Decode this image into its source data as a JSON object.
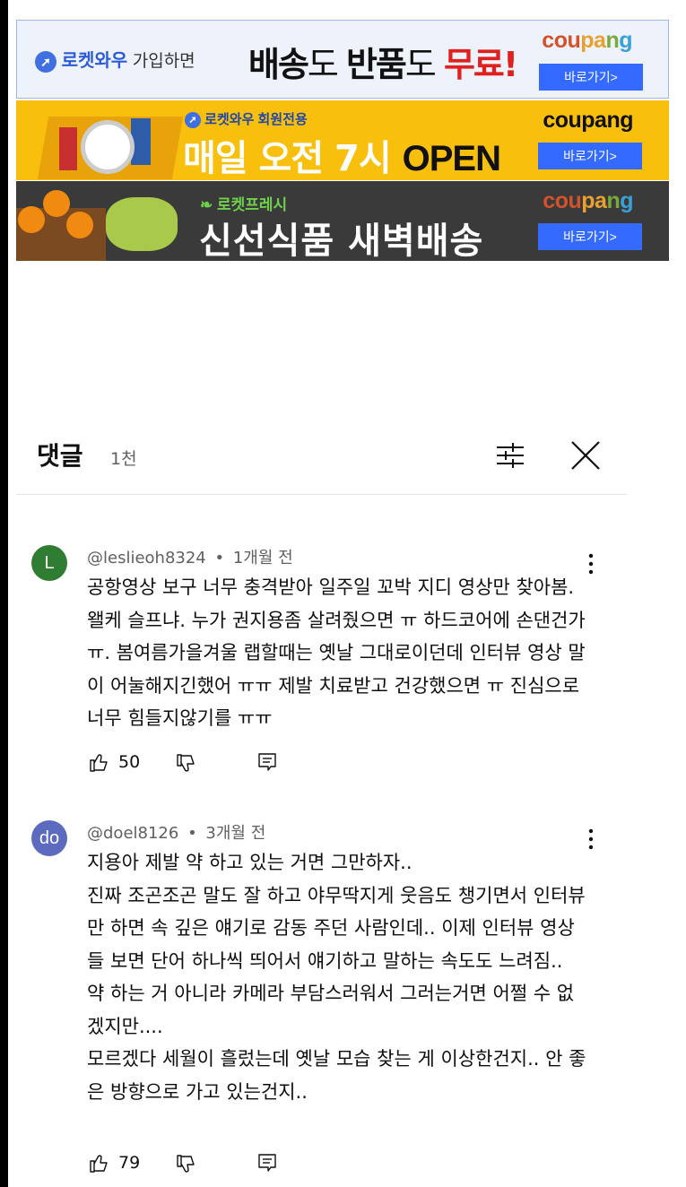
{
  "ads": {
    "banner1": {
      "brand": "로켓와우",
      "line": "가입하면",
      "big_a": "배송",
      "big_b": "도 ",
      "big_c": "반품",
      "big_d": "도 ",
      "big_e": "무료!",
      "button": "바로가기>"
    },
    "banner2": {
      "sub": "로켓와우 회원전용",
      "main_a": "매일 오전 7시 ",
      "main_b": "OPEN",
      "logo": "coupang",
      "button": "바로가기>"
    },
    "banner3": {
      "sub": "로켓프레시",
      "main": "신선식품 새벽배송",
      "button": "바로가기>"
    },
    "logo_parts": [
      "cou",
      "pa",
      "n",
      "g"
    ]
  },
  "comments_header": {
    "title": "댓글",
    "count": "1천"
  },
  "comments": [
    {
      "avatar_letter": "L",
      "avatar_color": "#2e7d32",
      "author": "@leslieoh8324",
      "dot": "•",
      "time": "1개월 전",
      "text": "공항영상 보구 너무  충격받아 일주일 꼬박 지디 영상만 찾아봄.왤케 슬프냐. 누가 권지용좀 살려줬으면 ㅠ 하드코어에 손댄건가 ㅠ.  봄여름가을겨울  랩할때는 옛날 그대로이던데 인터뷰 영상 말이 어눌해지긴했어 ㅠㅠ  제발 치료받고 건강했으면 ㅠ 진심으로 너무 힘들지않기를 ㅠㅠ",
      "likes": "50"
    },
    {
      "avatar_letter": "do",
      "avatar_color": "#5c6bc0",
      "author": "@doel8126",
      "dot": "•",
      "time": "3개월 전",
      "text": "지용아 제발 약 하고 있는 거면 그만하자..\n진짜 조곤조곤 말도 잘 하고 야무딱지게 웃음도 챙기면서 인터뷰만 하면 속 깊은 얘기로 감동 주던 사람인데.. 이제 인터뷰 영상들 보면 단어 하나씩 띄어서 얘기하고 말하는 속도도 느려짐..\n약 하는 거 아니라 카메라 부담스러워서 그러는거면 어쩔 수 없겠지만....\n모르겠다 세월이 흘렀는데 옛날 모습 찾는 게 이상한건지.. 안 좋은 방향으로 가고 있는건지..",
      "likes": "79"
    }
  ]
}
